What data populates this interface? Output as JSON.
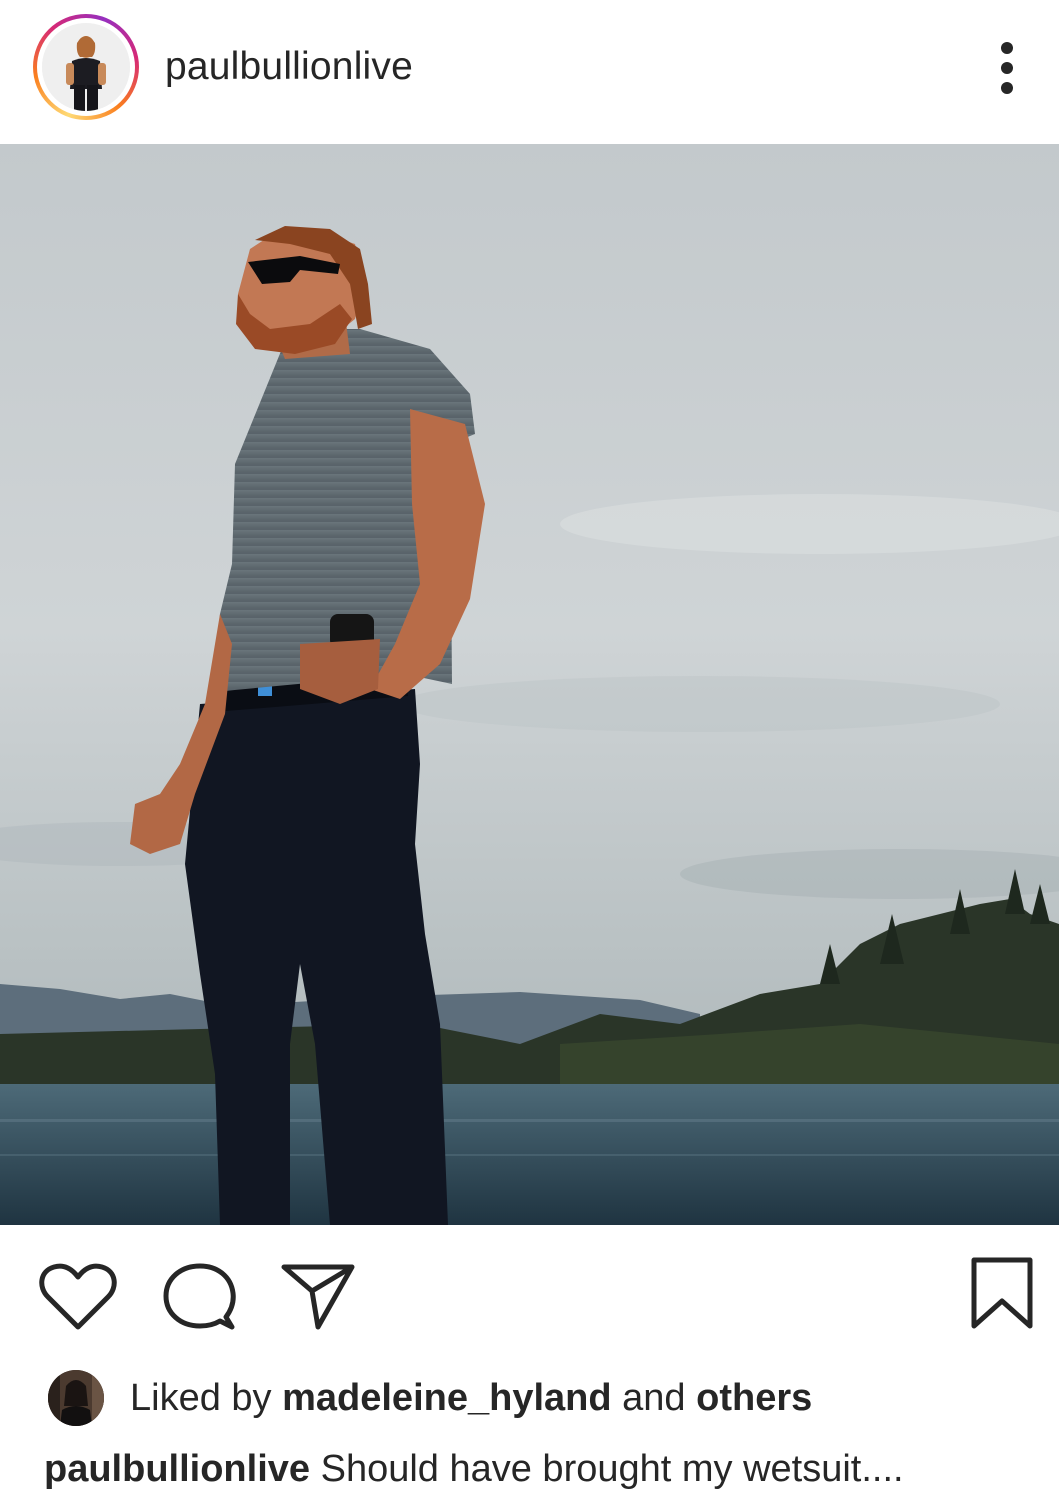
{
  "post": {
    "username": "paulbullionlive",
    "more_options_icon": "more-vertical-icon"
  },
  "actions": {
    "like_icon": "heart-icon",
    "comment_icon": "comment-icon",
    "share_icon": "send-icon",
    "save_icon": "bookmark-icon"
  },
  "likes": {
    "prefix": "Liked by",
    "liker": "madeleine_hyland",
    "conjunction": "and",
    "others": "others"
  },
  "caption": {
    "username": "paulbullionlive",
    "text": "Should have brought my wetsuit...."
  },
  "colors": {
    "text": "#262626",
    "ring_gradient": [
      "#feda75",
      "#fa7e1e",
      "#d62976",
      "#962fbf"
    ],
    "sky": "#c9ced0",
    "water": "#2f4a57"
  }
}
